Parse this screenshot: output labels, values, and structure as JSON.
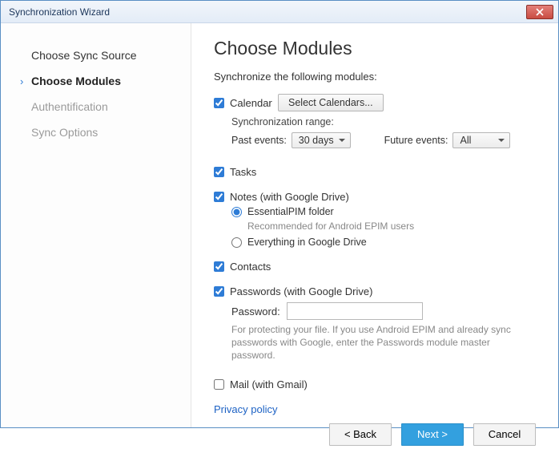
{
  "window": {
    "title": "Synchronization Wizard"
  },
  "sidebar": {
    "steps": [
      {
        "label": "Choose Sync Source"
      },
      {
        "label": "Choose Modules"
      },
      {
        "label": "Authentification"
      },
      {
        "label": "Sync Options"
      }
    ]
  },
  "main": {
    "heading": "Choose Modules",
    "subheading": "Synchronize the following modules:",
    "calendar": {
      "label": "Calendar",
      "select_btn": "Select Calendars...",
      "range_label": "Synchronization range:",
      "past_label": "Past events:",
      "past_value": "30 days",
      "future_label": "Future events:",
      "future_value": "All"
    },
    "tasks": {
      "label": "Tasks"
    },
    "notes": {
      "label": "Notes (with Google Drive)",
      "opt_epim": "EssentialPIM folder",
      "opt_epim_hint": "Recommended for Android EPIM users",
      "opt_all": "Everything in Google Drive"
    },
    "contacts": {
      "label": "Contacts"
    },
    "passwords": {
      "label": "Passwords (with Google Drive)",
      "pw_label": "Password:",
      "hint": "For protecting your file. If you use Android EPIM and already sync passwords with Google, enter the Passwords module master password."
    },
    "mail": {
      "label": "Mail (with Gmail)"
    },
    "privacy": "Privacy policy"
  },
  "footer": {
    "back": "< Back",
    "next": "Next >",
    "cancel": "Cancel"
  }
}
